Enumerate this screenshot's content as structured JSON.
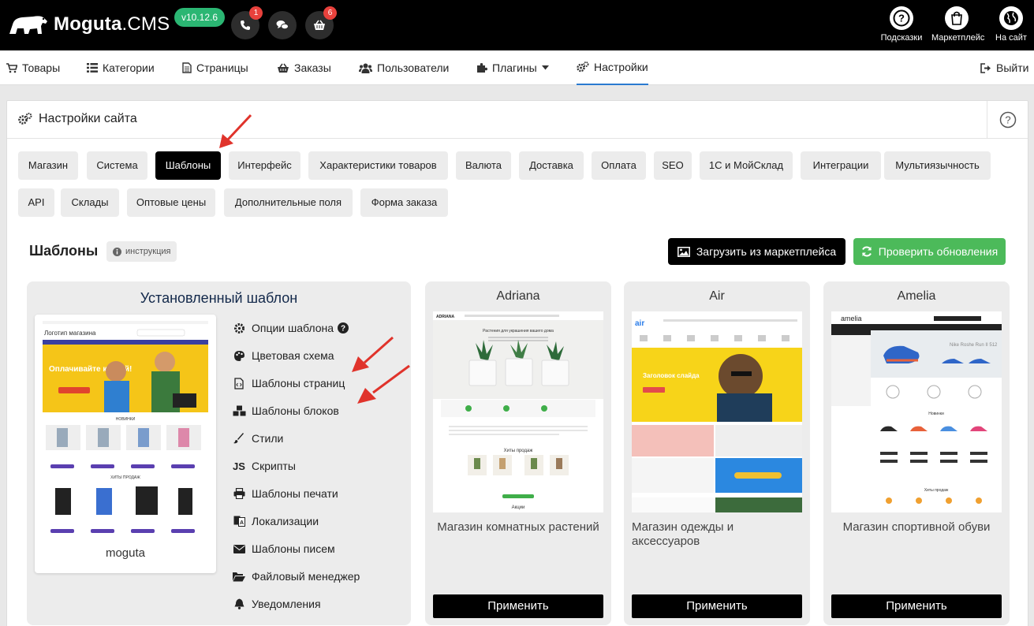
{
  "topbar": {
    "logo_name": "Moguta",
    "logo_suffix": ".CMS",
    "version": "v10.12.6",
    "phone_badge": "1",
    "cart_badge": "6",
    "right_buttons": [
      {
        "label": "Подсказки",
        "icon": "question-icon"
      },
      {
        "label": "Маркетплейс",
        "icon": "shopping-bag-icon"
      },
      {
        "label": "На сайт",
        "icon": "globe-icon"
      }
    ]
  },
  "nav": {
    "items": [
      {
        "label": "Товары",
        "icon": "cart-icon"
      },
      {
        "label": "Категории",
        "icon": "list-icon"
      },
      {
        "label": "Страницы",
        "icon": "file-icon"
      },
      {
        "label": "Заказы",
        "icon": "basket-icon"
      },
      {
        "label": "Пользователи",
        "icon": "users-icon"
      },
      {
        "label": "Плагины",
        "icon": "puzzle-icon"
      },
      {
        "label": "Настройки",
        "icon": "cogs-icon"
      }
    ],
    "active": "Настройки",
    "logout": "Выйти"
  },
  "panel": {
    "title": "Настройки сайта",
    "tabs_row1": [
      "Магазин",
      "Система",
      "Шаблоны",
      "Интерфейс",
      "Характеристики товаров",
      "Валюта",
      "Доставка",
      "Оплата",
      "SEO",
      "1С и МойСклад",
      "Интеграции",
      "Мультиязычность"
    ],
    "tabs_row2": [
      "API",
      "Склады",
      "Оптовые цены",
      "Дополнительные поля",
      "Форма заказа"
    ],
    "active_tab": "Шаблоны"
  },
  "templates": {
    "title": "Шаблоны",
    "instruction": "инструкция",
    "marketplace_button": "Загрузить из маркетплейса",
    "update_button": "Проверить обновления",
    "installed": {
      "heading": "Установленный шаблон",
      "name": "moguta",
      "preview": {
        "logo_text": "Логотип магазина",
        "banner_text": "Оплачивайте картой!",
        "section_new": "НОВИНКИ",
        "section_hits": "ХИТЫ ПРОДАЖ"
      },
      "menu": [
        {
          "label": "Опции шаблона",
          "icon": "cog-icon"
        },
        {
          "label": "Цветовая схема",
          "icon": "palette-icon"
        },
        {
          "label": "Шаблоны страниц",
          "icon": "file-code-icon"
        },
        {
          "label": "Шаблоны блоков",
          "icon": "cubes-icon"
        },
        {
          "label": "Стили",
          "icon": "brush-icon"
        },
        {
          "label": "Скрипты",
          "icon": "js-icon"
        },
        {
          "label": "Шаблоны печати",
          "icon": "print-icon"
        },
        {
          "label": "Локализации",
          "icon": "language-icon"
        },
        {
          "label": "Шаблоны писем",
          "icon": "envelope-icon"
        },
        {
          "label": "Файловый менеджер",
          "icon": "folder-open-icon"
        },
        {
          "label": "Уведомления",
          "icon": "bell-icon"
        }
      ],
      "js_glyph": "JS"
    },
    "cards": [
      {
        "name": "Adriana",
        "description": "Магазин комнатных растений",
        "apply": "Применить",
        "preview_logo": "ADRIANA",
        "preview_heading": "Растения для украшения вашего дома",
        "preview_hits": "Хиты продаж",
        "preview_sale": "Акции"
      },
      {
        "name": "Air",
        "description": "Магазин одежды и аксессуаров",
        "apply": "Применить",
        "preview_logo": "air",
        "preview_slide": "Заголовок слайда"
      },
      {
        "name": "Amelia",
        "description": "Магазин спортивной обуви",
        "apply": "Применить",
        "preview_logo": "amelia",
        "preview_banner": "Nike Roshe Run II 512",
        "preview_new": "Новинки",
        "preview_hits": "Хиты продаж"
      }
    ]
  },
  "colors": {
    "accent_blue": "#2a7ad0",
    "green": "#4cba5a",
    "badge_red": "#e8413c",
    "version_green": "#2bb673",
    "arrow_red": "#e0332b"
  }
}
